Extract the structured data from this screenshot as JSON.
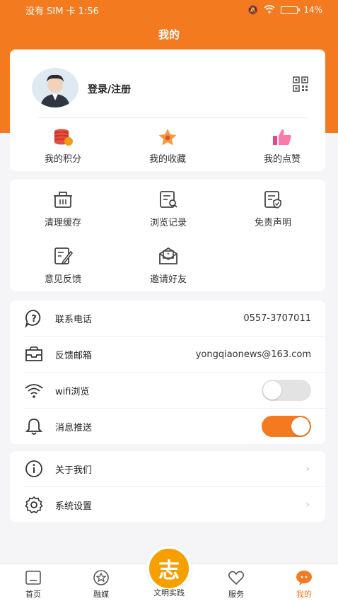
{
  "status_bar": {
    "left": "没有 SIM 卡 1:56",
    "battery": "14%"
  },
  "header": {
    "title": "我的"
  },
  "profile": {
    "login_label": "登录/注册"
  },
  "stats": [
    {
      "label": "我的积分",
      "icon": "points-coins-icon"
    },
    {
      "label": "我的收藏",
      "icon": "favorites-star-icon"
    },
    {
      "label": "我的点赞",
      "icon": "likes-thumb-icon"
    }
  ],
  "tools": [
    {
      "label": "清理缓存",
      "icon": "clear-cache-icon"
    },
    {
      "label": "浏览记录",
      "icon": "browse-history-icon"
    },
    {
      "label": "免责声明",
      "icon": "disclaimer-icon"
    },
    {
      "label": "意见反馈",
      "icon": "feedback-edit-icon"
    },
    {
      "label": "邀请好友",
      "icon": "invite-friends-icon"
    }
  ],
  "settings": {
    "phone_label": "联系电话",
    "phone_value": "0557-3707011",
    "email_label": "反馈邮箱",
    "email_value": "yongqiaonews@163.com",
    "wifi_label": "wifi浏览",
    "wifi_on": false,
    "push_label": "消息推送",
    "push_on": true
  },
  "more": {
    "about_label": "关于我们",
    "system_label": "系统设置"
  },
  "tabbar": {
    "items": [
      {
        "label": "首页"
      },
      {
        "label": "融媒"
      },
      {
        "label": "文明实践"
      },
      {
        "label": "服务"
      },
      {
        "label": "我的"
      }
    ],
    "center_glyph": "志",
    "active": "我的"
  },
  "colors": {
    "accent": "#f47a20",
    "center_button": "#f5a000"
  }
}
